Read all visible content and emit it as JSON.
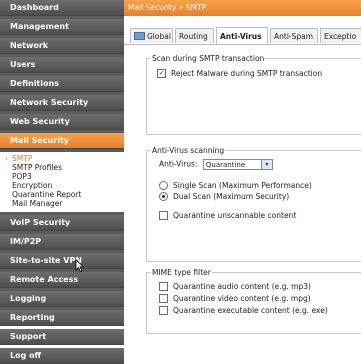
{
  "sidebar": {
    "items_top": [
      {
        "label": "Dashboard"
      },
      {
        "label": "Management"
      },
      {
        "label": "Network"
      },
      {
        "label": "Users"
      },
      {
        "label": "Definitions"
      },
      {
        "label": "Network Security"
      },
      {
        "label": "Web Security"
      }
    ],
    "active_item": {
      "label": "Mail Security"
    },
    "submenu": [
      {
        "label": "SMTP"
      },
      {
        "label": "SMTP Profiles"
      },
      {
        "label": "POP3"
      },
      {
        "label": "Encryption"
      },
      {
        "label": "Quarantine Report"
      },
      {
        "label": "Mail Manager"
      }
    ],
    "items_bottom": [
      {
        "label": "VoIP Security"
      },
      {
        "label": "IM/P2P"
      },
      {
        "label": "Site-to-site VPN"
      },
      {
        "label": "Remote Access"
      },
      {
        "label": "Logging"
      },
      {
        "label": "Reporting"
      },
      {
        "label": "Support"
      },
      {
        "label": "Log off"
      }
    ]
  },
  "header": {
    "breadcrumb": "Mail Security » SMTP"
  },
  "tabs": [
    {
      "label": "Global"
    },
    {
      "label": "Routing"
    },
    {
      "label": "Anti-Virus"
    },
    {
      "label": "Anti-Spam"
    },
    {
      "label": "Exceptio"
    }
  ],
  "scan_group": {
    "legend": "Scan during SMTP transaction",
    "reject_label": "Reject Malware during SMTP transaction",
    "reject_checked": "✓"
  },
  "av_group": {
    "legend": "Anti-Virus scanning",
    "av_label": "Anti-Virus:",
    "av_value": "Quarantine",
    "single_label": "Single Scan (Maximum Performance)",
    "dual_label": "Dual Scan (Maximum Security)",
    "quarantine_label": "Quarantine unscannable content"
  },
  "mime_group": {
    "legend": "MIME type filter",
    "audio_label": "Quarantine audio content (e.g. mp3)",
    "video_label": "Quarantine video content (e.g. mpg)",
    "exe_label": "Quarantine executable content (e.g. exe)"
  },
  "colors": {
    "accent": "#e8792b",
    "sidebar_bg": "#5c5c5c"
  }
}
